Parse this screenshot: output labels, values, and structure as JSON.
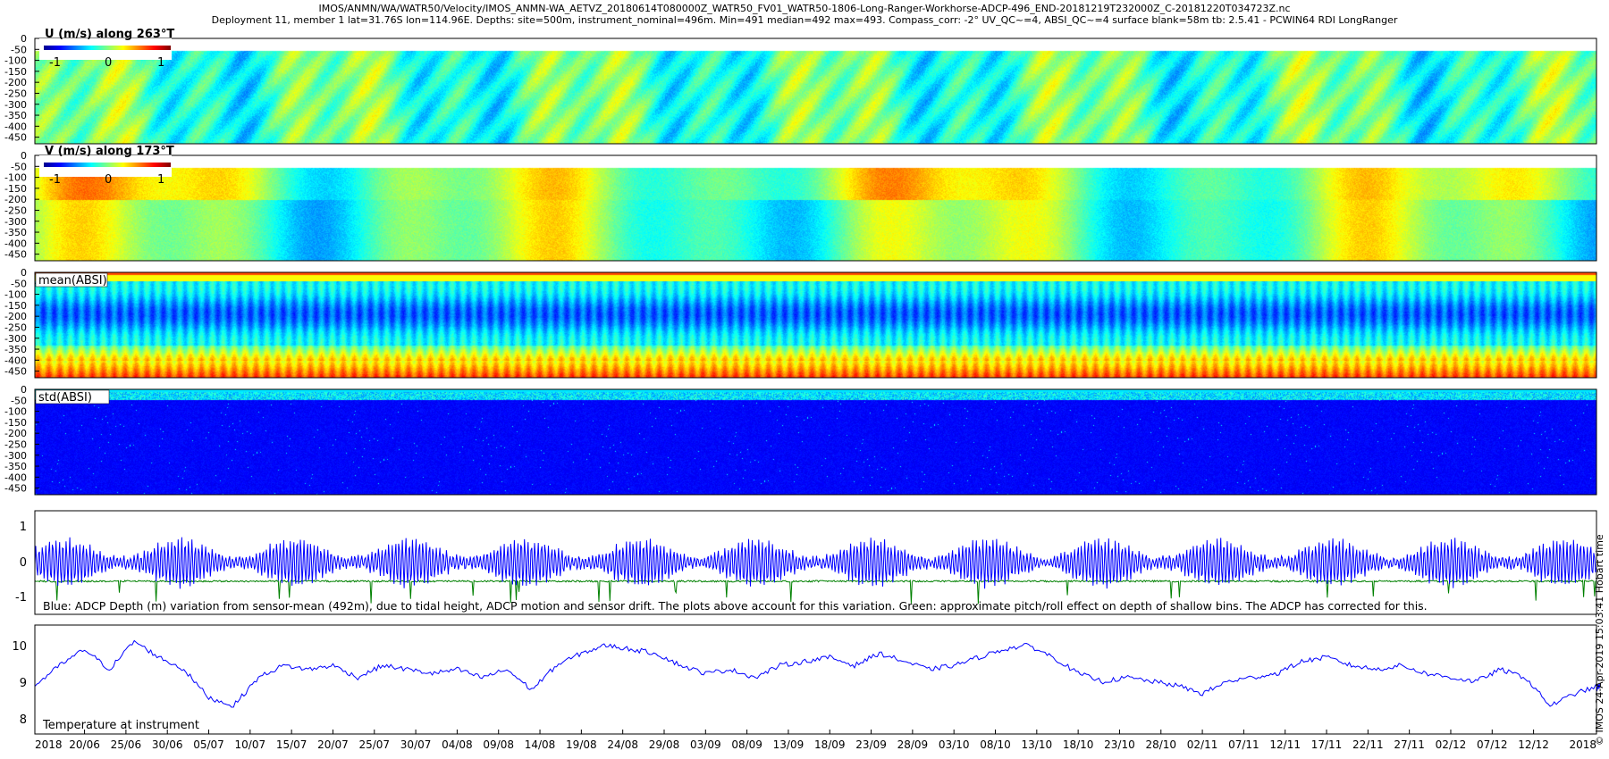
{
  "header": {
    "line1": "IMOS/ANMN/WA/WATR50/Velocity/IMOS_ANMN-WA_AETVZ_20180614T080000Z_WATR50_FV01_WATR50-1806-Long-Ranger-Workhorse-ADCP-496_END-20181219T232000Z_C-20181220T034723Z.nc",
    "line2": "Deployment 11, member 1 lat=31.76S lon=114.96E. Depths: site=500m, instrument_nominal=496m. Min=491 median=492 max=493. Compass_corr: -2° UV_QC~=4, ABSI_QC~=4 surface blank=58m tb: 2.5.41 - PCWIN64 RDI LongRanger"
  },
  "colors": {
    "jet": [
      "#00008f",
      "#0000ff",
      "#0080ff",
      "#00ffff",
      "#80ff80",
      "#ffff00",
      "#ff8000",
      "#ff0000",
      "#800000"
    ],
    "depth_line": "#0000ff",
    "pitch_roll_line": "#008000",
    "temperature_line": "#0000ff"
  },
  "colorbar": {
    "ticks": [
      "-1",
      "0",
      "1"
    ]
  },
  "depth_ticks": [
    "0",
    "-50",
    "-100",
    "-150",
    "-200",
    "-250",
    "-300",
    "-350",
    "-400",
    "-450"
  ],
  "panels": {
    "u": {
      "label": "U (m/s) along 263°T"
    },
    "v": {
      "label": "V (m/s) along 173°T"
    },
    "mean_absi": {
      "label": "mean(ABSI)"
    },
    "std_absi": {
      "label": "std(ABSI)"
    },
    "depth": {
      "y_ticks": [
        "1",
        "0",
        "-1"
      ],
      "caption": "Blue: ADCP Depth (m) variation from sensor-mean (492m), due to tidal height, ADCP motion and sensor drift. The plots above account for this variation. Green: approximate pitch/roll effect on depth of shallow bins. The ADCP has corrected for this."
    },
    "temperature": {
      "y_ticks": [
        "10",
        "9",
        "8"
      ],
      "label": "Temperature at instrument"
    }
  },
  "side_text": "© IMOS 24-Apr-2019 15:03:41 Hobart time",
  "chart_data": [
    {
      "type": "heatmap",
      "title": "U (m/s) along 263°T",
      "x_range": [
        "2018-06-14",
        "2018-12-19"
      ],
      "ylim": [
        -480,
        0
      ],
      "clim": [
        -1.2,
        1.2
      ],
      "colormap": "jet"
    },
    {
      "type": "heatmap",
      "title": "V (m/s) along 173°T",
      "x_range": [
        "2018-06-14",
        "2018-12-19"
      ],
      "ylim": [
        -480,
        0
      ],
      "clim": [
        -1.2,
        1.2
      ],
      "colormap": "jet"
    },
    {
      "type": "heatmap",
      "title": "mean(ABSI)",
      "x_range": [
        "2018-06-14",
        "2018-12-19"
      ],
      "ylim": [
        -480,
        0
      ],
      "colormap": "jet"
    },
    {
      "type": "heatmap",
      "title": "std(ABSI)",
      "x_range": [
        "2018-06-14",
        "2018-12-19"
      ],
      "ylim": [
        -480,
        0
      ],
      "colormap": "jet"
    },
    {
      "type": "line",
      "ylim": [
        -1.5,
        1.5
      ],
      "series": [
        {
          "name": "Blue",
          "color": "#0000ff",
          "min": -1.3,
          "max": 1.1
        },
        {
          "name": "Green",
          "color": "#008000",
          "baseline": -0.55,
          "min": -1.4
        }
      ]
    },
    {
      "type": "line",
      "ylim": [
        7.6,
        10.3
      ],
      "x_ticks": [
        "2018",
        "20/06",
        "25/06",
        "30/06",
        "05/07",
        "10/07",
        "15/07",
        "20/07",
        "25/07",
        "30/07",
        "04/08",
        "09/08",
        "14/08",
        "19/08",
        "24/08",
        "29/08",
        "03/09",
        "08/09",
        "13/09",
        "18/09",
        "23/09",
        "28/09",
        "03/10",
        "08/10",
        "13/10",
        "18/10",
        "23/10",
        "28/10",
        "02/11",
        "07/11",
        "12/11",
        "17/11",
        "22/11",
        "27/11",
        "02/12",
        "07/12",
        "12/12",
        "2018"
      ],
      "series": [
        {
          "name": "Temperature at instrument",
          "color": "#0000ff",
          "x_days_since_start": [
            0,
            3,
            6,
            9,
            12,
            15,
            18,
            21,
            24,
            27,
            30,
            33,
            36,
            39,
            42,
            45,
            48,
            51,
            54,
            57,
            60,
            63,
            66,
            69,
            72,
            75,
            78,
            81,
            84,
            87,
            90,
            93,
            96,
            99,
            102,
            105,
            108,
            111,
            114,
            117,
            120,
            123,
            126,
            129,
            132,
            135,
            138,
            141,
            144,
            147,
            150,
            153,
            156,
            159,
            162,
            165,
            168,
            171,
            174,
            177,
            180,
            183,
            186,
            189,
            188.6
          ],
          "values": [
            8.8,
            9.3,
            9.7,
            9.2,
            9.9,
            9.5,
            9.2,
            8.5,
            8.3,
            9.0,
            9.3,
            9.2,
            9.3,
            9.0,
            9.3,
            9.2,
            9.1,
            9.2,
            9.0,
            9.2,
            8.7,
            9.3,
            9.6,
            9.8,
            9.7,
            9.6,
            9.3,
            9.1,
            9.2,
            9.0,
            9.3,
            9.4,
            9.5,
            9.3,
            9.6,
            9.4,
            9.2,
            9.3,
            9.5,
            9.7,
            9.8,
            9.5,
            9.1,
            8.9,
            9.0,
            8.9,
            8.8,
            8.6,
            8.9,
            9.0,
            9.1,
            9.4,
            9.5,
            9.3,
            9.2,
            9.3,
            9.1,
            9.0,
            8.9,
            9.2,
            9.0,
            8.3,
            8.6,
            8.8,
            8.7
          ]
        }
      ]
    }
  ]
}
